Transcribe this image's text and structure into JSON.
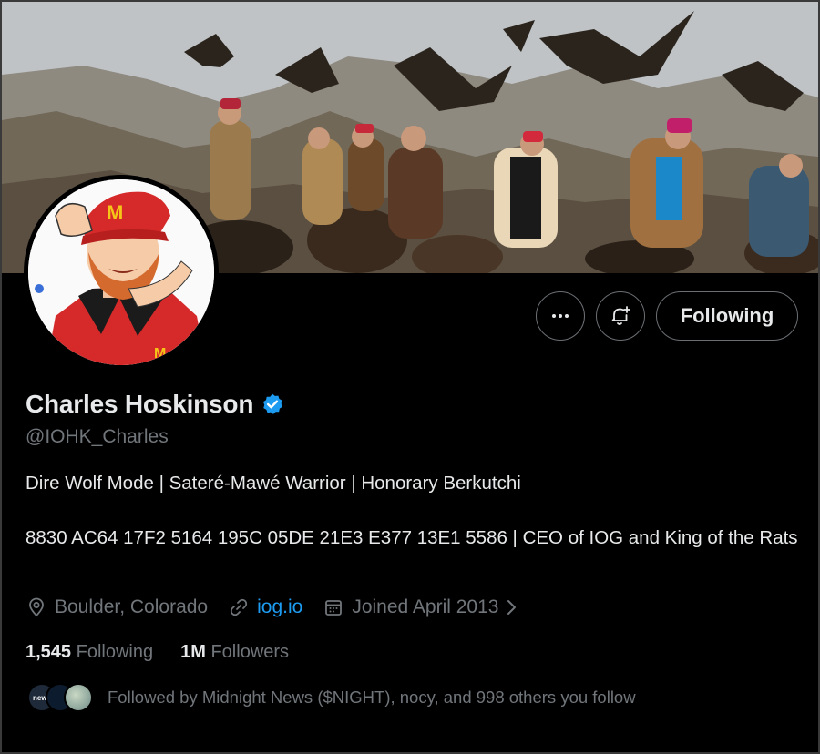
{
  "profile": {
    "name": "Charles Hoskinson",
    "handle": "@IOHK_Charles",
    "verified": true,
    "bio_line1": "Dire Wolf Mode | Sateré-Mawé Warrior | Honorary Berkutchi",
    "bio_line2": "8830 AC64 17F2 5164 195C 05DE 21E3 E377 13E1 5586 | CEO of IOG and King of the Rats"
  },
  "meta": {
    "location": "Boulder, Colorado",
    "website": "iog.io",
    "joined": "Joined April 2013"
  },
  "stats": {
    "following_count": "1,545",
    "following_label": "Following",
    "followers_count": "1M",
    "followers_label": "Followers"
  },
  "followed_by": {
    "text": "Followed by Midnight News ($NIGHT), nocy, and 998 others you follow",
    "avatar1_label": "news"
  },
  "actions": {
    "more_icon": "more-icon",
    "notify_icon": "bell-plus-icon",
    "following_label": "Following"
  },
  "colors": {
    "accent": "#1d9bf0",
    "verified": "#1d9bf0",
    "muted": "#71767b"
  }
}
